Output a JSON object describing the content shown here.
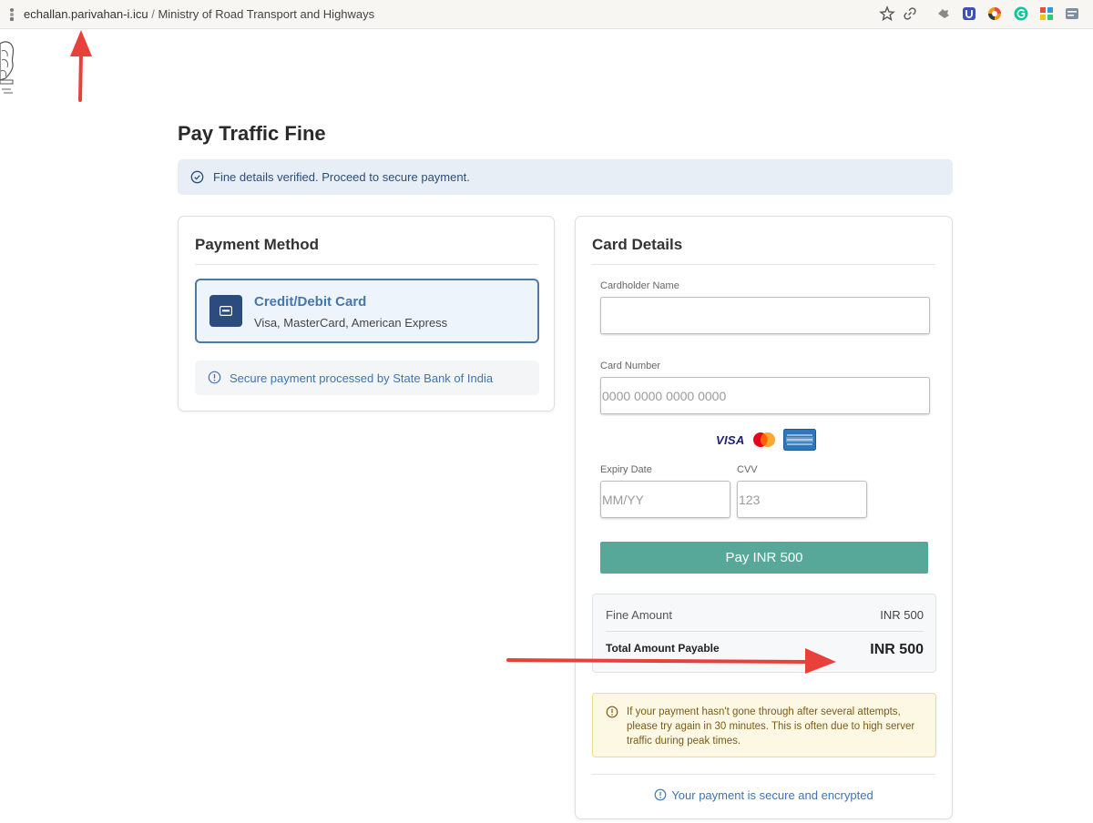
{
  "browser": {
    "url_host": "echallan.parivahan-i.icu",
    "url_separator": " / ",
    "page_title": "Ministry of Road Transport and Highways",
    "toolbar_icons": [
      "star-icon",
      "link-icon",
      "extension-icon",
      "extension-u-icon",
      "extension-circle-icon",
      "grammarly-icon",
      "extension-grid-icon",
      "extension-list-icon"
    ]
  },
  "page": {
    "title": "Pay Traffic Fine",
    "verified_message": "Fine details verified. Proceed to secure payment."
  },
  "payment_method": {
    "title": "Payment Method",
    "option_title": "Credit/Debit Card",
    "option_subtitle": "Visa, MasterCard, American Express",
    "bank_note": "Secure payment processed by State Bank of India"
  },
  "card_details": {
    "title": "Card Details",
    "cardholder_label": "Cardholder Name",
    "cardholder_placeholder": "",
    "card_number_label": "Card Number",
    "card_number_placeholder": "0000 0000 0000 0000",
    "brands": [
      "VISA",
      "MasterCard",
      "AMERICAN EXPRESS"
    ],
    "expiry_label": "Expiry Date",
    "expiry_placeholder": "MM/YY",
    "cvv_label": "CVV",
    "cvv_placeholder": "123",
    "pay_button": "Pay INR 500",
    "fine_amount_label": "Fine Amount",
    "fine_amount_value": "INR 500",
    "total_label": "Total Amount Payable",
    "total_value": "INR 500",
    "warning": "If your payment hasn't gone through after several attempts, please try again in 30 minutes. This is often due to high server traffic during peak times.",
    "secure_note": "Your payment is secure and encrypted"
  },
  "colors": {
    "accent": "#4676aa",
    "pay_button": "#58a89a",
    "card_icon_bg": "#2c4b7e",
    "annotation_arrow": "#e8413c"
  }
}
